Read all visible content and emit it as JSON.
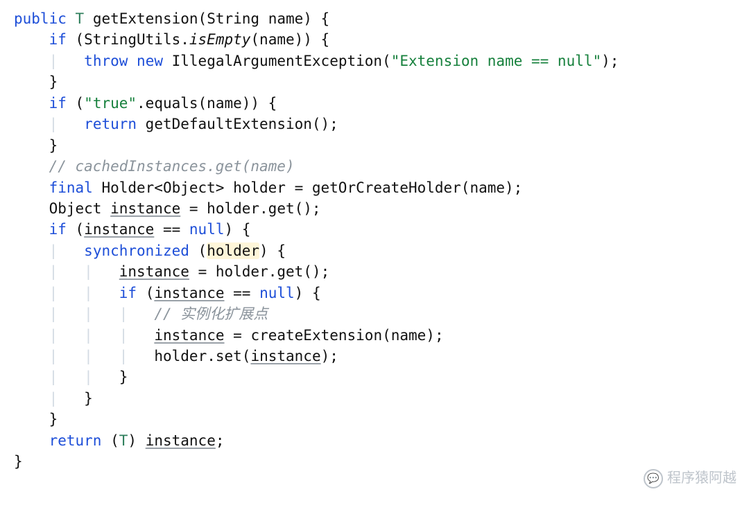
{
  "code": {
    "l1": {
      "kw1": "public",
      "type": "T",
      "method": "getExtension",
      "param": "(String name) {"
    },
    "l2": {
      "kw": "if",
      "prefix": " (StringUtils.",
      "stat": "isEmpty",
      "suffix": "(name)) {"
    },
    "l3": {
      "kw1": "throw",
      "kw2": "new",
      "ex": " IllegalArgumentException(",
      "str": "\"Extension name == null\"",
      "tail": ");"
    },
    "l4": "}",
    "l5": {
      "kw": "if",
      "open": " (",
      "str": "\"true\"",
      "mid": ".equals(name)) {"
    },
    "l6": {
      "kw": "return",
      "rest": " getDefaultExtension();"
    },
    "l7": "}",
    "l8": "// cachedInstances.get(name)",
    "l9": {
      "kw": "final",
      "rest": " Holder<Object> holder = getOrCreateHolder(name);"
    },
    "l10": {
      "pre": "Object ",
      "var": "instance",
      "post": " = holder.get();"
    },
    "l11": {
      "kw": "if",
      "open": " (",
      "var": "instance",
      "mid": " == ",
      "nul": "null",
      "close": ") {"
    },
    "l12": {
      "kw": "synchronized",
      "open": " (",
      "hl": "holder",
      "close": ") {"
    },
    "l13": {
      "var": "instance",
      "rest": " = holder.get();"
    },
    "l14": {
      "kw": "if",
      "open": " (",
      "var": "instance",
      "mid": " == ",
      "nul": "null",
      "close": ") {"
    },
    "l15": "// 实例化扩展点",
    "l16": {
      "var": "instance",
      "rest": " = createExtension(name);"
    },
    "l17": {
      "pre": "holder.set(",
      "var": "instance",
      "post": ");"
    },
    "l18": "}",
    "l19": "}",
    "l20": "}",
    "l21": {
      "kw": "return",
      "open": " (",
      "tpar": "T",
      "close": ") ",
      "var": "instance",
      "semi": ";"
    },
    "l22": "}"
  },
  "watermark": {
    "text": "程序猿阿越"
  }
}
